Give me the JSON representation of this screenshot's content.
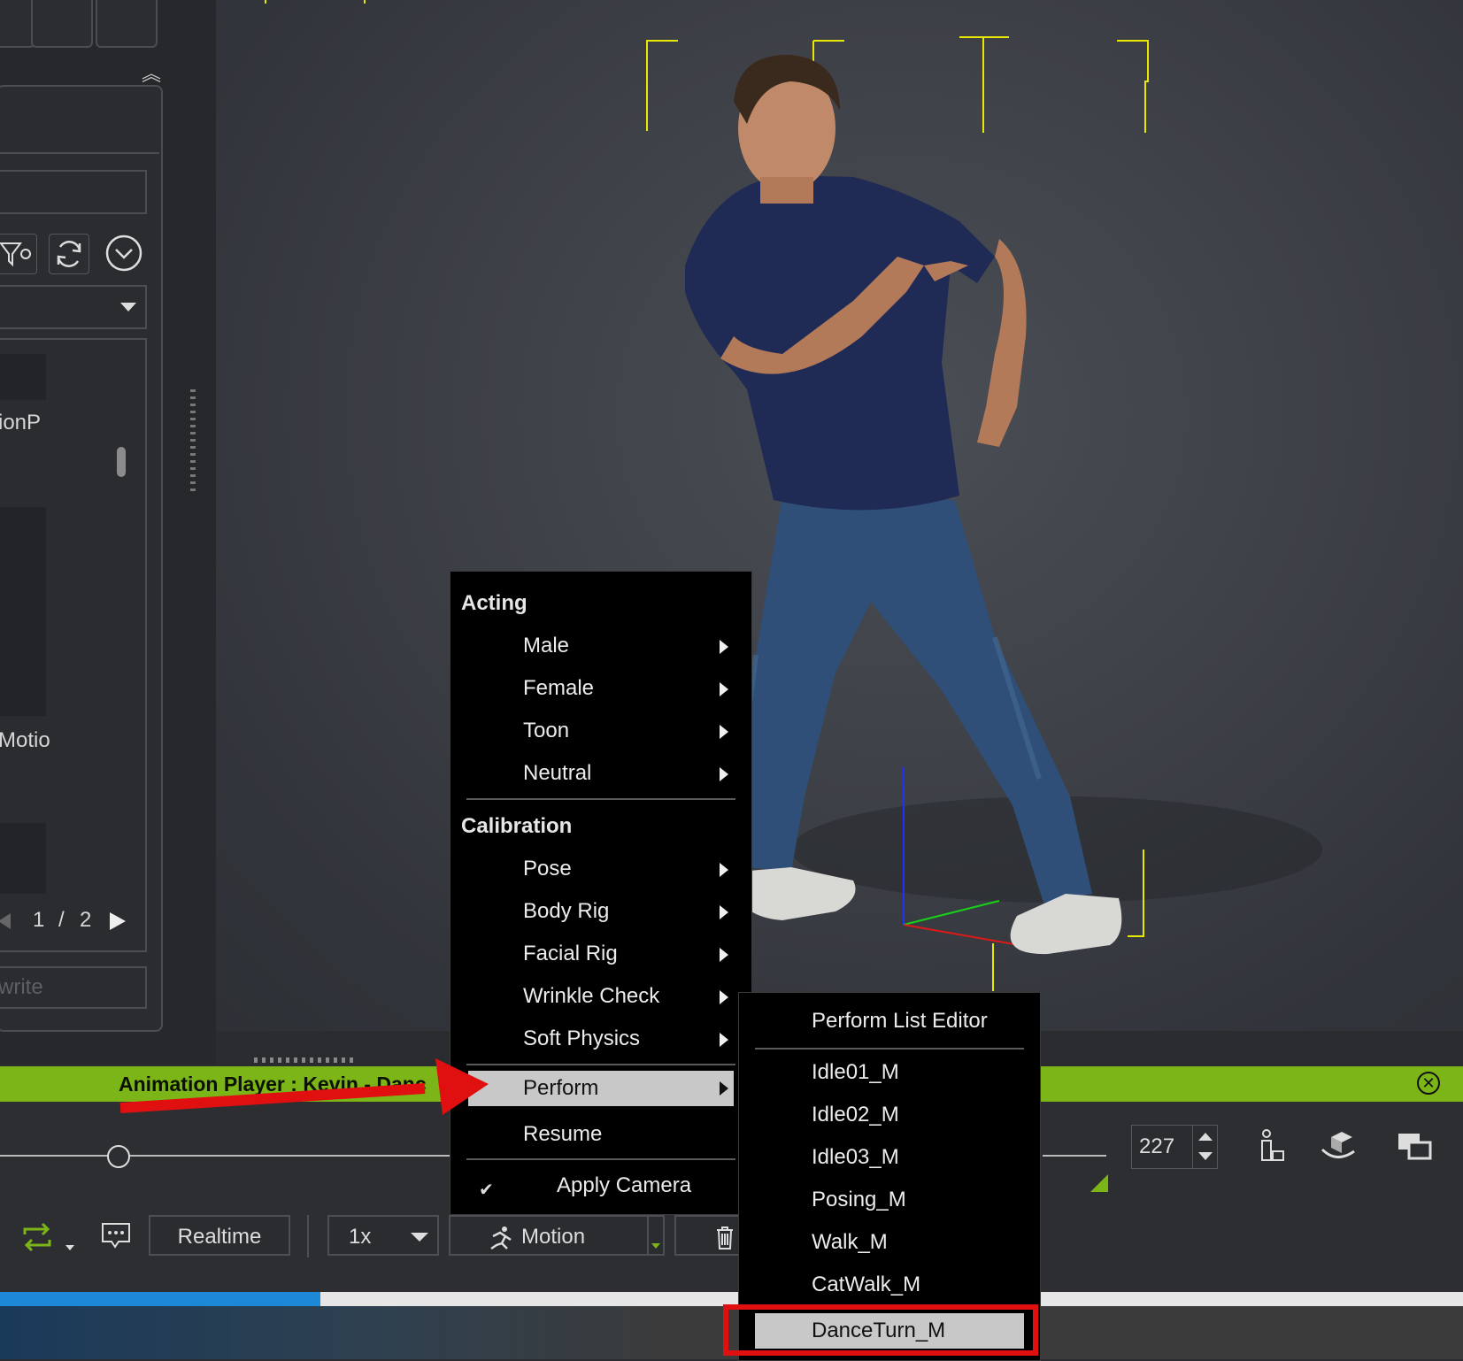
{
  "left_panel": {
    "library_label": "ionP",
    "motion_label": "Motio",
    "pager": {
      "current": "1",
      "separator": "/",
      "total": "2"
    },
    "write_placeholder": "write"
  },
  "player": {
    "title": "Animation Player : Kevin - Danc",
    "frame_value": "227",
    "realtime_label": "Realtime",
    "speed_label": "1x",
    "motion_label": "Motion",
    "accent_color": "#7cb518"
  },
  "context_menu": {
    "section_acting": "Acting",
    "acting_items": [
      "Male",
      "Female",
      "Toon",
      "Neutral"
    ],
    "section_calibration": "Calibration",
    "calibration_items": [
      "Pose",
      "Body Rig",
      "Facial Rig",
      "Wrinkle Check",
      "Soft Physics"
    ],
    "perform": "Perform",
    "resume": "Resume",
    "apply_camera": "Apply Camera"
  },
  "perform_submenu": {
    "editor": "Perform List Editor",
    "items": [
      "Idle01_M",
      "Idle02_M",
      "Idle03_M",
      "Posing_M",
      "Walk_M",
      "CatWalk_M",
      "DanceTurn_M"
    ],
    "selected": "DanceTurn_M"
  },
  "annotation_color": "#e01010"
}
